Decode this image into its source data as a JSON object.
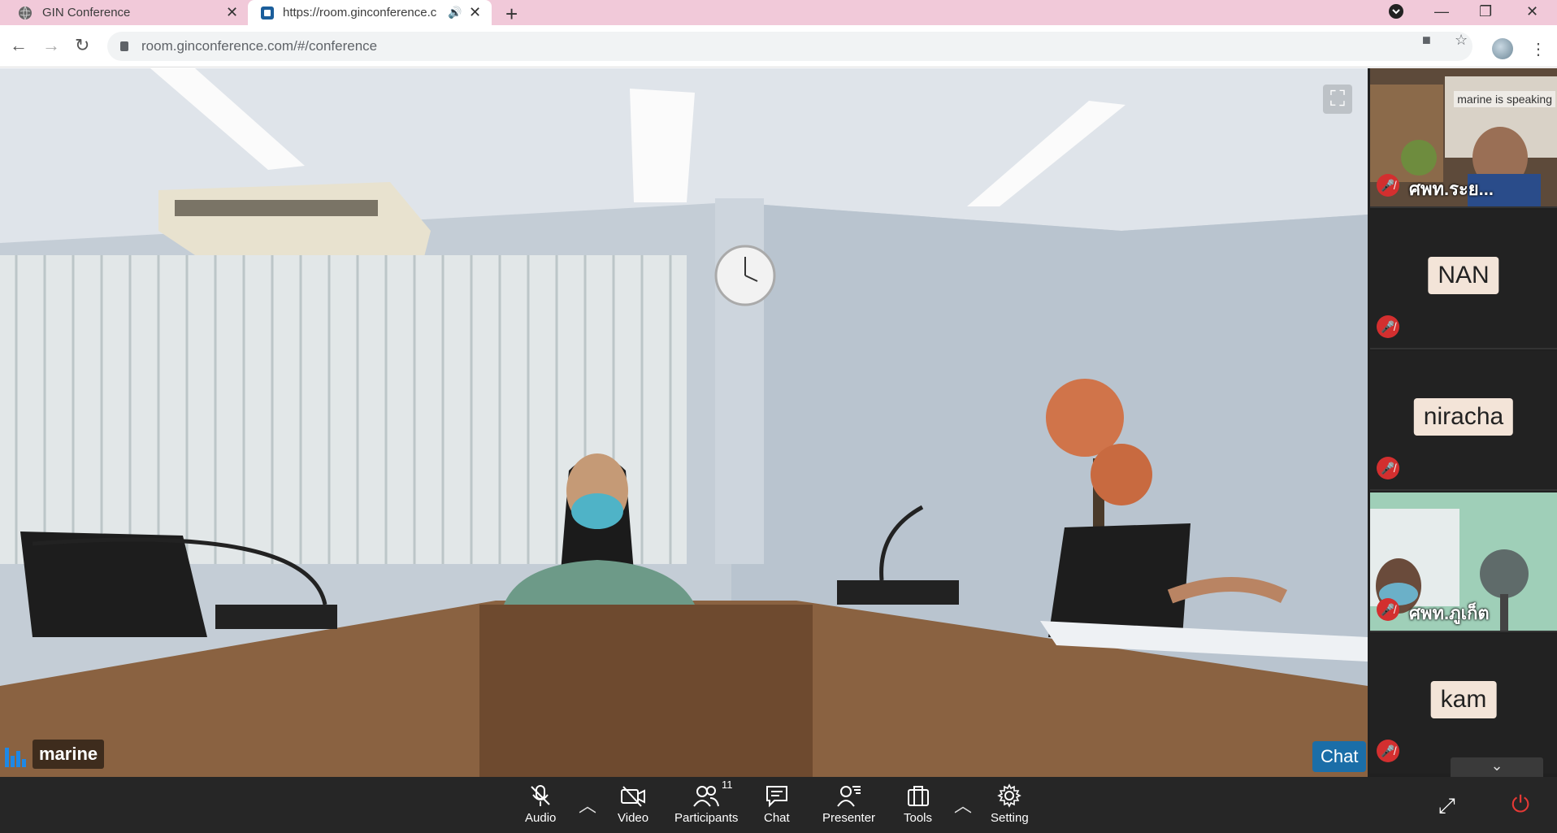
{
  "browser": {
    "tabs": [
      {
        "title": "GIN Conference",
        "active": false
      },
      {
        "title": "https://room.ginconference.c",
        "active": true
      }
    ],
    "url": "room.ginconference.com/#/conference"
  },
  "main_video": {
    "speaker_name": "marine",
    "chat_button": "Chat"
  },
  "participants": [
    {
      "name": "ศพท.ระย...",
      "status_label": "marine is speaking",
      "has_video": true,
      "mic": "muted"
    },
    {
      "name": "NAN",
      "has_video": false,
      "mic": "muted"
    },
    {
      "name": "niracha",
      "has_video": false,
      "mic": "muted"
    },
    {
      "name": "ศพท.ภูเก็ต",
      "has_video": true,
      "mic": "muted"
    },
    {
      "name": "kam",
      "has_video": false,
      "mic": "muted"
    }
  ],
  "toolbar": {
    "audio": "Audio",
    "video": "Video",
    "participants": "Participants",
    "participants_count": "11",
    "chat": "Chat",
    "presenter": "Presenter",
    "tools": "Tools",
    "setting": "Setting"
  },
  "colors": {
    "tabbar": "#f1c9d9",
    "toolbar": "#262626",
    "mic_muted": "#d32f2f",
    "chat_button": "#1b6ea8",
    "end_call": "#e53935"
  }
}
